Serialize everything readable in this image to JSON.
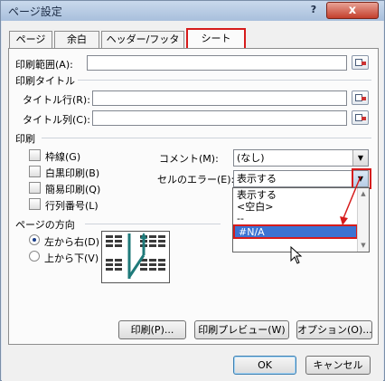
{
  "window": {
    "title": "ページ設定",
    "help_glyph": "?",
    "close_glyph": "x"
  },
  "tabs": [
    {
      "label": "ページ",
      "active": false
    },
    {
      "label": "余白",
      "active": false
    },
    {
      "label": "ヘッダー/フッター",
      "active": false
    },
    {
      "label": "シート",
      "active": true
    }
  ],
  "print_area": {
    "label": "印刷範囲(A):",
    "value": ""
  },
  "print_titles": {
    "heading": "印刷タイトル",
    "rows_label": "タイトル行(R):",
    "rows_value": "",
    "cols_label": "タイトル列(C):",
    "cols_value": ""
  },
  "print": {
    "heading": "印刷",
    "checkboxes": [
      {
        "label": "枠線(G)",
        "checked": false
      },
      {
        "label": "白黒印刷(B)",
        "checked": false
      },
      {
        "label": "簡易印刷(Q)",
        "checked": false
      },
      {
        "label": "行列番号(L)",
        "checked": false
      }
    ],
    "comments_label": "コメント(M):",
    "comments_value": "(なし)",
    "errors_label": "セルのエラー(E):",
    "errors_value": "表示する",
    "errors_options": [
      "表示する",
      "<空白>",
      "--",
      "#N/A"
    ],
    "errors_highlighted": "#N/A"
  },
  "page_order": {
    "heading": "ページの方向",
    "options": [
      {
        "label": "左から右(D)",
        "selected": true
      },
      {
        "label": "上から下(V)",
        "selected": false
      }
    ]
  },
  "bottom_buttons": {
    "print": "印刷(P)...",
    "preview": "印刷プレビュー(W)",
    "options": "オプション(O)...",
    "ok": "OK",
    "cancel": "キャンセル"
  },
  "colors": {
    "highlight_red": "#d61b1b",
    "selection_blue": "#3b73d3",
    "arrow_teal": "#1f7a7a"
  }
}
